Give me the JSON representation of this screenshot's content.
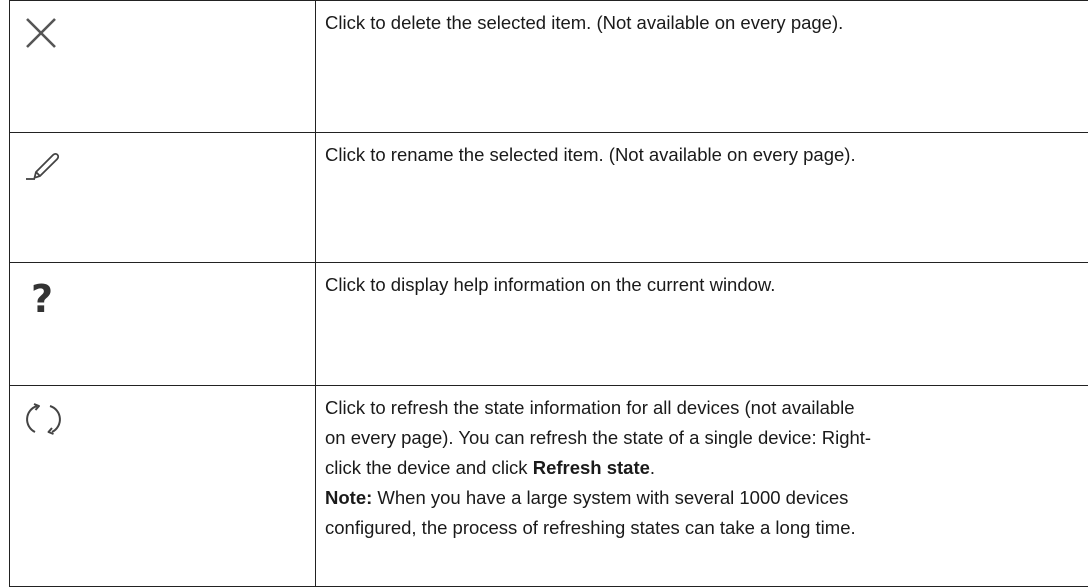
{
  "rows": [
    {
      "icon": "close-icon",
      "description": "Click to delete the selected item. (Not available on every page)."
    },
    {
      "icon": "pencil-icon",
      "description": "Click to rename the selected item. (Not available on every page)."
    },
    {
      "icon": "help-icon",
      "description": "Click to display help information on the current window."
    },
    {
      "icon": "refresh-icon",
      "lines": {
        "l1": "Click to refresh the state information for all devices (not available",
        "l2": "on every page). You can refresh the state of a single device: Right-",
        "l3a": "click the device and click ",
        "l3b": "Refresh state",
        "l3c": ".",
        "l4a": "Note:",
        "l4b": " When you have a large system with several 1000 devices",
        "l5": "configured, the process of refreshing states can take a long time."
      }
    }
  ],
  "help_glyph": "?"
}
